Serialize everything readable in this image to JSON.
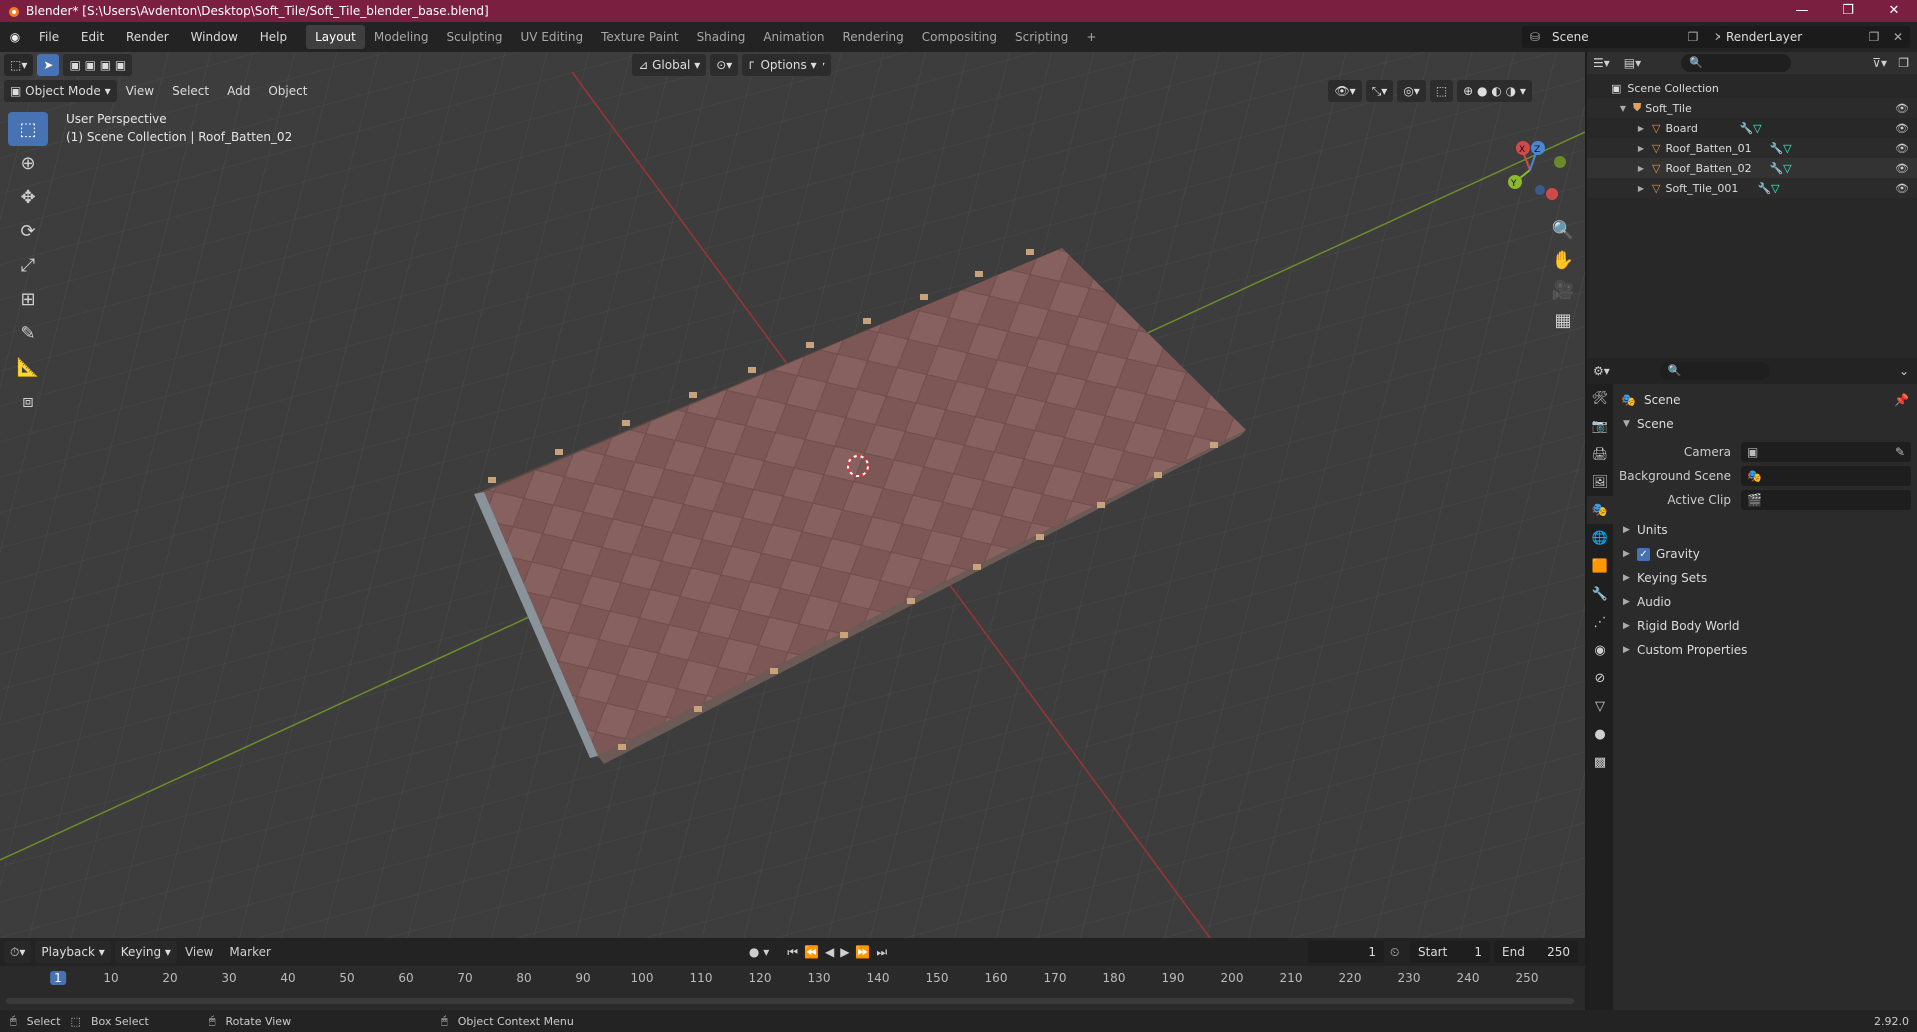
{
  "window": {
    "title": "Blender* [S:\\Users\\Avdenton\\Desktop\\Soft_Tile/Soft_Tile_blender_base.blend]",
    "minimize": "—",
    "maximize": "❐",
    "close": "✕"
  },
  "menu": [
    "File",
    "Edit",
    "Render",
    "Window",
    "Help"
  ],
  "workspaces": [
    "Layout",
    "Modeling",
    "Sculpting",
    "UV Editing",
    "Texture Paint",
    "Shading",
    "Animation",
    "Rendering",
    "Compositing",
    "Scripting"
  ],
  "active_workspace": "Layout",
  "scene_name": "Scene",
  "render_layer": "RenderLayer",
  "viewport": {
    "mode": "Object Mode",
    "menus": [
      "View",
      "Select",
      "Add",
      "Object"
    ],
    "transform_orientation": "Global",
    "options_label": "Options",
    "perspective_label": "User Perspective",
    "collection_label": "(1) Scene Collection | Roof_Batten_02",
    "axis_labels": {
      "x": "X",
      "y": "Y",
      "z": "Z"
    }
  },
  "outliner": {
    "root": "Scene Collection",
    "collection": "Soft_Tile",
    "items": [
      "Board",
      "Roof_Batten_01",
      "Roof_Batten_02",
      "Soft_Tile_001"
    ],
    "selected": "Roof_Batten_02"
  },
  "properties": {
    "header": "Scene",
    "panel": "Scene",
    "fields": [
      {
        "label": "Camera",
        "value": ""
      },
      {
        "label": "Background Scene",
        "value": ""
      },
      {
        "label": "Active Clip",
        "value": ""
      }
    ],
    "sections": [
      "Units",
      "Gravity",
      "Keying Sets",
      "Audio",
      "Rigid Body World",
      "Custom Properties"
    ],
    "gravity_checked": true
  },
  "timeline": {
    "menus": [
      "Playback",
      "Keying",
      "View",
      "Marker"
    ],
    "current_frame": "1",
    "start_label": "Start",
    "start": "1",
    "end_label": "End",
    "end": "250",
    "ticks": [
      "1",
      "10",
      "20",
      "30",
      "40",
      "50",
      "60",
      "70",
      "80",
      "90",
      "100",
      "110",
      "120",
      "130",
      "140",
      "150",
      "160",
      "170",
      "180",
      "190",
      "200",
      "210",
      "220",
      "230",
      "240",
      "250"
    ]
  },
  "status": {
    "select": "Select",
    "box_select": "Box Select",
    "rotate_view": "Rotate View",
    "context_menu": "Object Context Menu",
    "version": "2.92.0"
  }
}
